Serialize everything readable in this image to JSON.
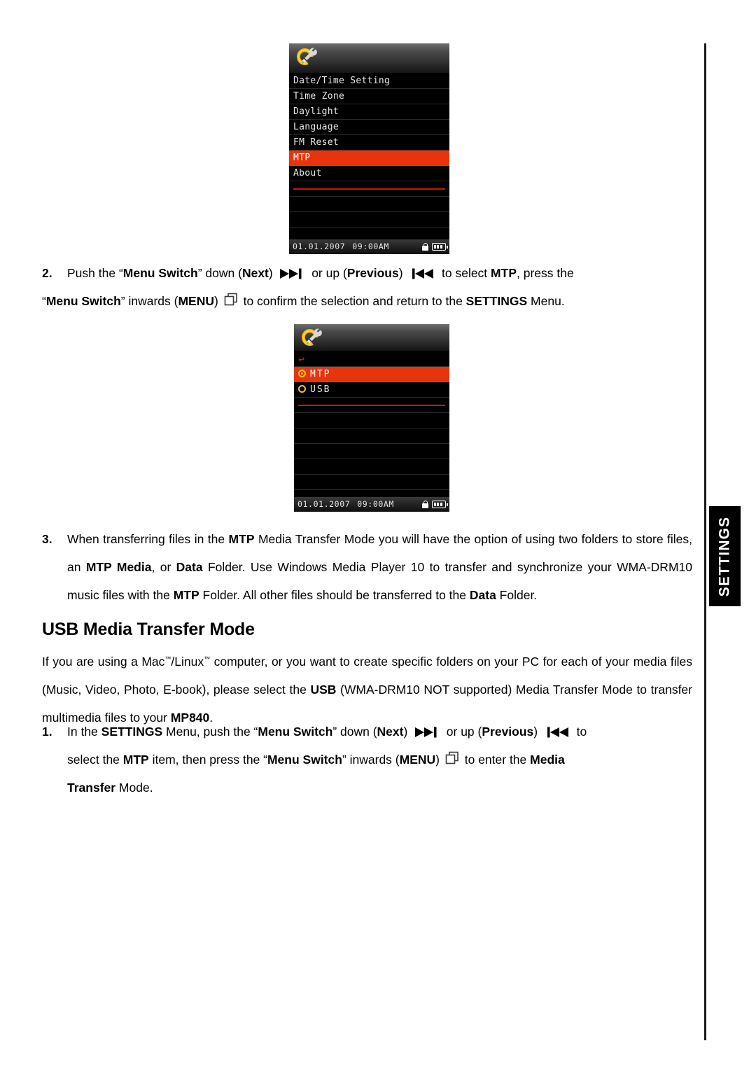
{
  "page": {
    "side_tab_label": "SETTINGS"
  },
  "device_screen_1": {
    "name": "settings-menu-screen",
    "header_icon": "gear-wrench-icon",
    "rows": [
      {
        "label": "Date/Time Setting",
        "selected": false
      },
      {
        "label": "Time Zone",
        "selected": false
      },
      {
        "label": "Daylight",
        "selected": false
      },
      {
        "label": "Language",
        "selected": false
      },
      {
        "label": "FM Reset",
        "selected": false
      },
      {
        "label": "MTP",
        "selected": true
      },
      {
        "label": "About",
        "selected": false
      }
    ],
    "status": {
      "date": "01.01.2007",
      "time": "09:00AM",
      "lock_icon": "lock-icon",
      "battery_icon": "battery-icon"
    }
  },
  "device_screen_2": {
    "name": "mtp-usb-selection-screen",
    "header_icon": "gear-wrench-icon",
    "back_glyph": "↩",
    "options": [
      {
        "label": "MTP",
        "selected": true
      },
      {
        "label": "USB",
        "selected": false
      }
    ],
    "status": {
      "date": "01.01.2007",
      "time": "09:00AM",
      "lock_icon": "lock-icon",
      "battery_icon": "battery-icon"
    }
  },
  "steps": {
    "step2_number": "2.",
    "step2_line1_a": "Push the “",
    "step2_line1_b": "Menu Switch",
    "step2_line1_c": "” down (",
    "step2_line1_d": "Next",
    "step2_line1_e": ")",
    "step2_line1_f": "or up (",
    "step2_line1_g": "Previous",
    "step2_line1_h": ")",
    "step2_line1_i": "to select ",
    "step2_line1_j": "MTP",
    "step2_line1_k": ", press the",
    "step2_line2_a": "“",
    "step2_line2_b": "Menu Switch",
    "step2_line2_c": "” inwards (",
    "step2_line2_d": "MENU",
    "step2_line2_e": ")",
    "step2_line2_f": "to confirm the selection and return to the ",
    "step2_line2_g": "SETTINGS",
    "step2_line2_h": " Menu.",
    "step3_number": "3.",
    "step3_a": "When transferring files in the ",
    "step3_b": "MTP",
    "step3_c": " Media Transfer Mode you will have the option of using two folders to store files, an ",
    "step3_d": "MTP Media",
    "step3_e": ", or ",
    "step3_f": "Data",
    "step3_g": " Folder. Use Windows Media Player 10 to transfer and synchronize your WMA-DRM10 music files with the ",
    "step3_h": "MTP",
    "step3_i": " Folder. All other files should be transferred to the ",
    "step3_j": "Data",
    "step3_k": " Folder.",
    "usb_step1_number": "1.",
    "usb_step1_a": "In the ",
    "usb_step1_b": "SETTINGS",
    "usb_step1_c": " Menu, push the “",
    "usb_step1_d": "Menu Switch",
    "usb_step1_e": "” down (",
    "usb_step1_f": "Next",
    "usb_step1_g": ")",
    "usb_step1_h": "or up (",
    "usb_step1_i": "Previous",
    "usb_step1_j": ")",
    "usb_step1_k": "to",
    "usb_step1_l": "select the ",
    "usb_step1_m": "MTP",
    "usb_step1_n": " item, then press the “",
    "usb_step1_o": "Menu Switch",
    "usb_step1_p": "” inwards (",
    "usb_step1_q": "MENU",
    "usb_step1_r": ")",
    "usb_step1_s": "to enter the ",
    "usb_step1_t": "Media",
    "usb_step1_u": "Transfer",
    "usb_step1_v": " Mode."
  },
  "usb_section": {
    "heading": "USB Media Transfer Mode",
    "body_a": "If you are using a Mac",
    "body_tm1": "™",
    "body_b": "/Linux",
    "body_tm2": "™",
    "body_c": " computer, or you want to create specific folders on your PC for each of your media files (Music, Video, Photo, E-book), please select the ",
    "body_d": "USB",
    "body_e": " (WMA-DRM10 NOT supported) Media Transfer Mode to transfer multimedia files to your ",
    "body_f": "MP840",
    "body_g": "."
  },
  "colors": {
    "selection_red": "#e8340c",
    "rule_red": "#c41a06",
    "radio_gold": "#f5c518",
    "screen_black": "#000000"
  }
}
